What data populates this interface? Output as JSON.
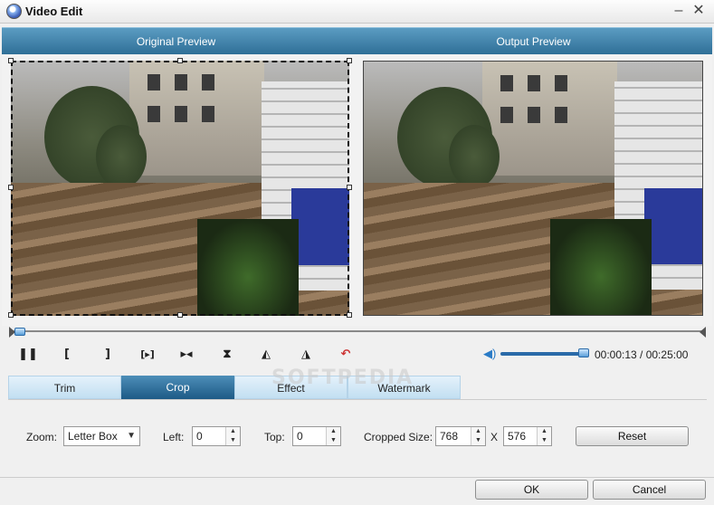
{
  "window": {
    "title": "Video Edit",
    "minimize_icon": "minimize-icon",
    "close_icon": "close-icon"
  },
  "preview": {
    "original_label": "Original Preview",
    "output_label": "Output Preview"
  },
  "playback": {
    "controls": [
      "pause-icon",
      "set-start-icon",
      "set-end-icon",
      "next-frame-icon",
      "skip-icon",
      "split-icon",
      "flip-left-icon",
      "flip-right-icon",
      "undo-icon"
    ],
    "pause": "❚❚",
    "mark_in": "[",
    "mark_out": "]",
    "step": "[▸]",
    "skip": "▸◂",
    "split": "⧗",
    "flip_a": "◭",
    "flip_b": "◮",
    "undo": "↶",
    "volume_icon": "speaker-icon",
    "volume_symbol": "◀)",
    "volume_level": 0.9,
    "timeline_position": 0.0,
    "time_display": "00:00:13 / 00:25:00"
  },
  "tabs": [
    {
      "label": "Trim",
      "active": false
    },
    {
      "label": "Crop",
      "active": true
    },
    {
      "label": "Effect",
      "active": false
    },
    {
      "label": "Watermark",
      "active": false
    }
  ],
  "overlay_text": "SOFTPEDIA",
  "crop": {
    "zoom_label": "Zoom:",
    "zoom_value": "Letter Box",
    "left_label": "Left:",
    "left_value": "0",
    "top_label": "Top:",
    "top_value": "0",
    "cropped_size_label": "Cropped Size:",
    "width_value": "768",
    "x_label": "X",
    "height_value": "576",
    "reset_label": "Reset"
  },
  "footer": {
    "ok_label": "OK",
    "cancel_label": "Cancel"
  },
  "colors": {
    "header_blue": "#2f6f97",
    "tab_active": "#1d5a86",
    "tab_inactive": "#c2dff1",
    "slider_blue": "#2a6aa8"
  }
}
